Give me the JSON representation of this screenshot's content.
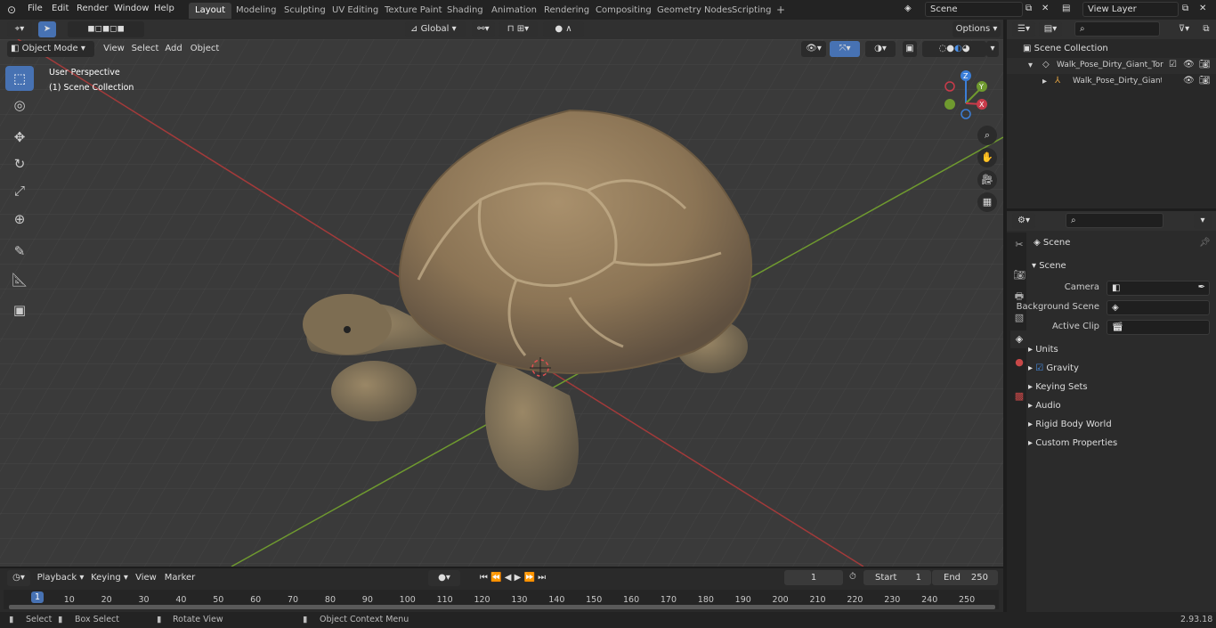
{
  "menu": {
    "items": [
      "File",
      "Edit",
      "Render",
      "Window",
      "Help"
    ]
  },
  "workspaces": [
    "Layout",
    "Modeling",
    "Sculpting",
    "UV Editing",
    "Texture Paint",
    "Shading",
    "Animation",
    "Rendering",
    "Compositing",
    "Geometry Nodes",
    "Scripting"
  ],
  "active_workspace": "Layout",
  "scene_field": "Scene",
  "view_layer_field": "View Layer",
  "header": {
    "mode": "Object Mode",
    "view": "View",
    "select": "Select",
    "add": "Add",
    "object": "Object",
    "orientation": "Global",
    "options": "Options"
  },
  "viewport": {
    "perspective": "User Perspective",
    "collection": "(1) Scene Collection",
    "gizmo": {
      "x": "X",
      "y": "Y",
      "z": "Z"
    }
  },
  "outliner": {
    "root": "Scene Collection",
    "items": [
      {
        "label": "Walk_Pose_Dirty_Giant_Tortoi"
      },
      {
        "label": "Walk_Pose_Dirty_Giant_T"
      }
    ]
  },
  "properties": {
    "context": "Scene",
    "panel": "Scene",
    "camera_label": "Camera",
    "background_scene_label": "Background Scene",
    "active_clip_label": "Active Clip",
    "sections": [
      "Units",
      "Gravity",
      "Keying Sets",
      "Audio",
      "Rigid Body World",
      "Custom Properties"
    ]
  },
  "timeline": {
    "playback": "Playback",
    "keying": "Keying",
    "view": "View",
    "marker": "Marker",
    "current_frame": "1",
    "start_label": "Start",
    "start_value": "1",
    "end_label": "End",
    "end_value": "250",
    "ticks": [
      "1",
      "10",
      "20",
      "30",
      "40",
      "50",
      "60",
      "70",
      "80",
      "90",
      "100",
      "110",
      "120",
      "130",
      "140",
      "150",
      "160",
      "170",
      "180",
      "190",
      "200",
      "210",
      "220",
      "230",
      "240",
      "250"
    ]
  },
  "status": {
    "select": "Select",
    "box_select": "Box Select",
    "rotate_view": "Rotate View",
    "context_menu": "Object Context Menu",
    "version": "2.93.18"
  }
}
